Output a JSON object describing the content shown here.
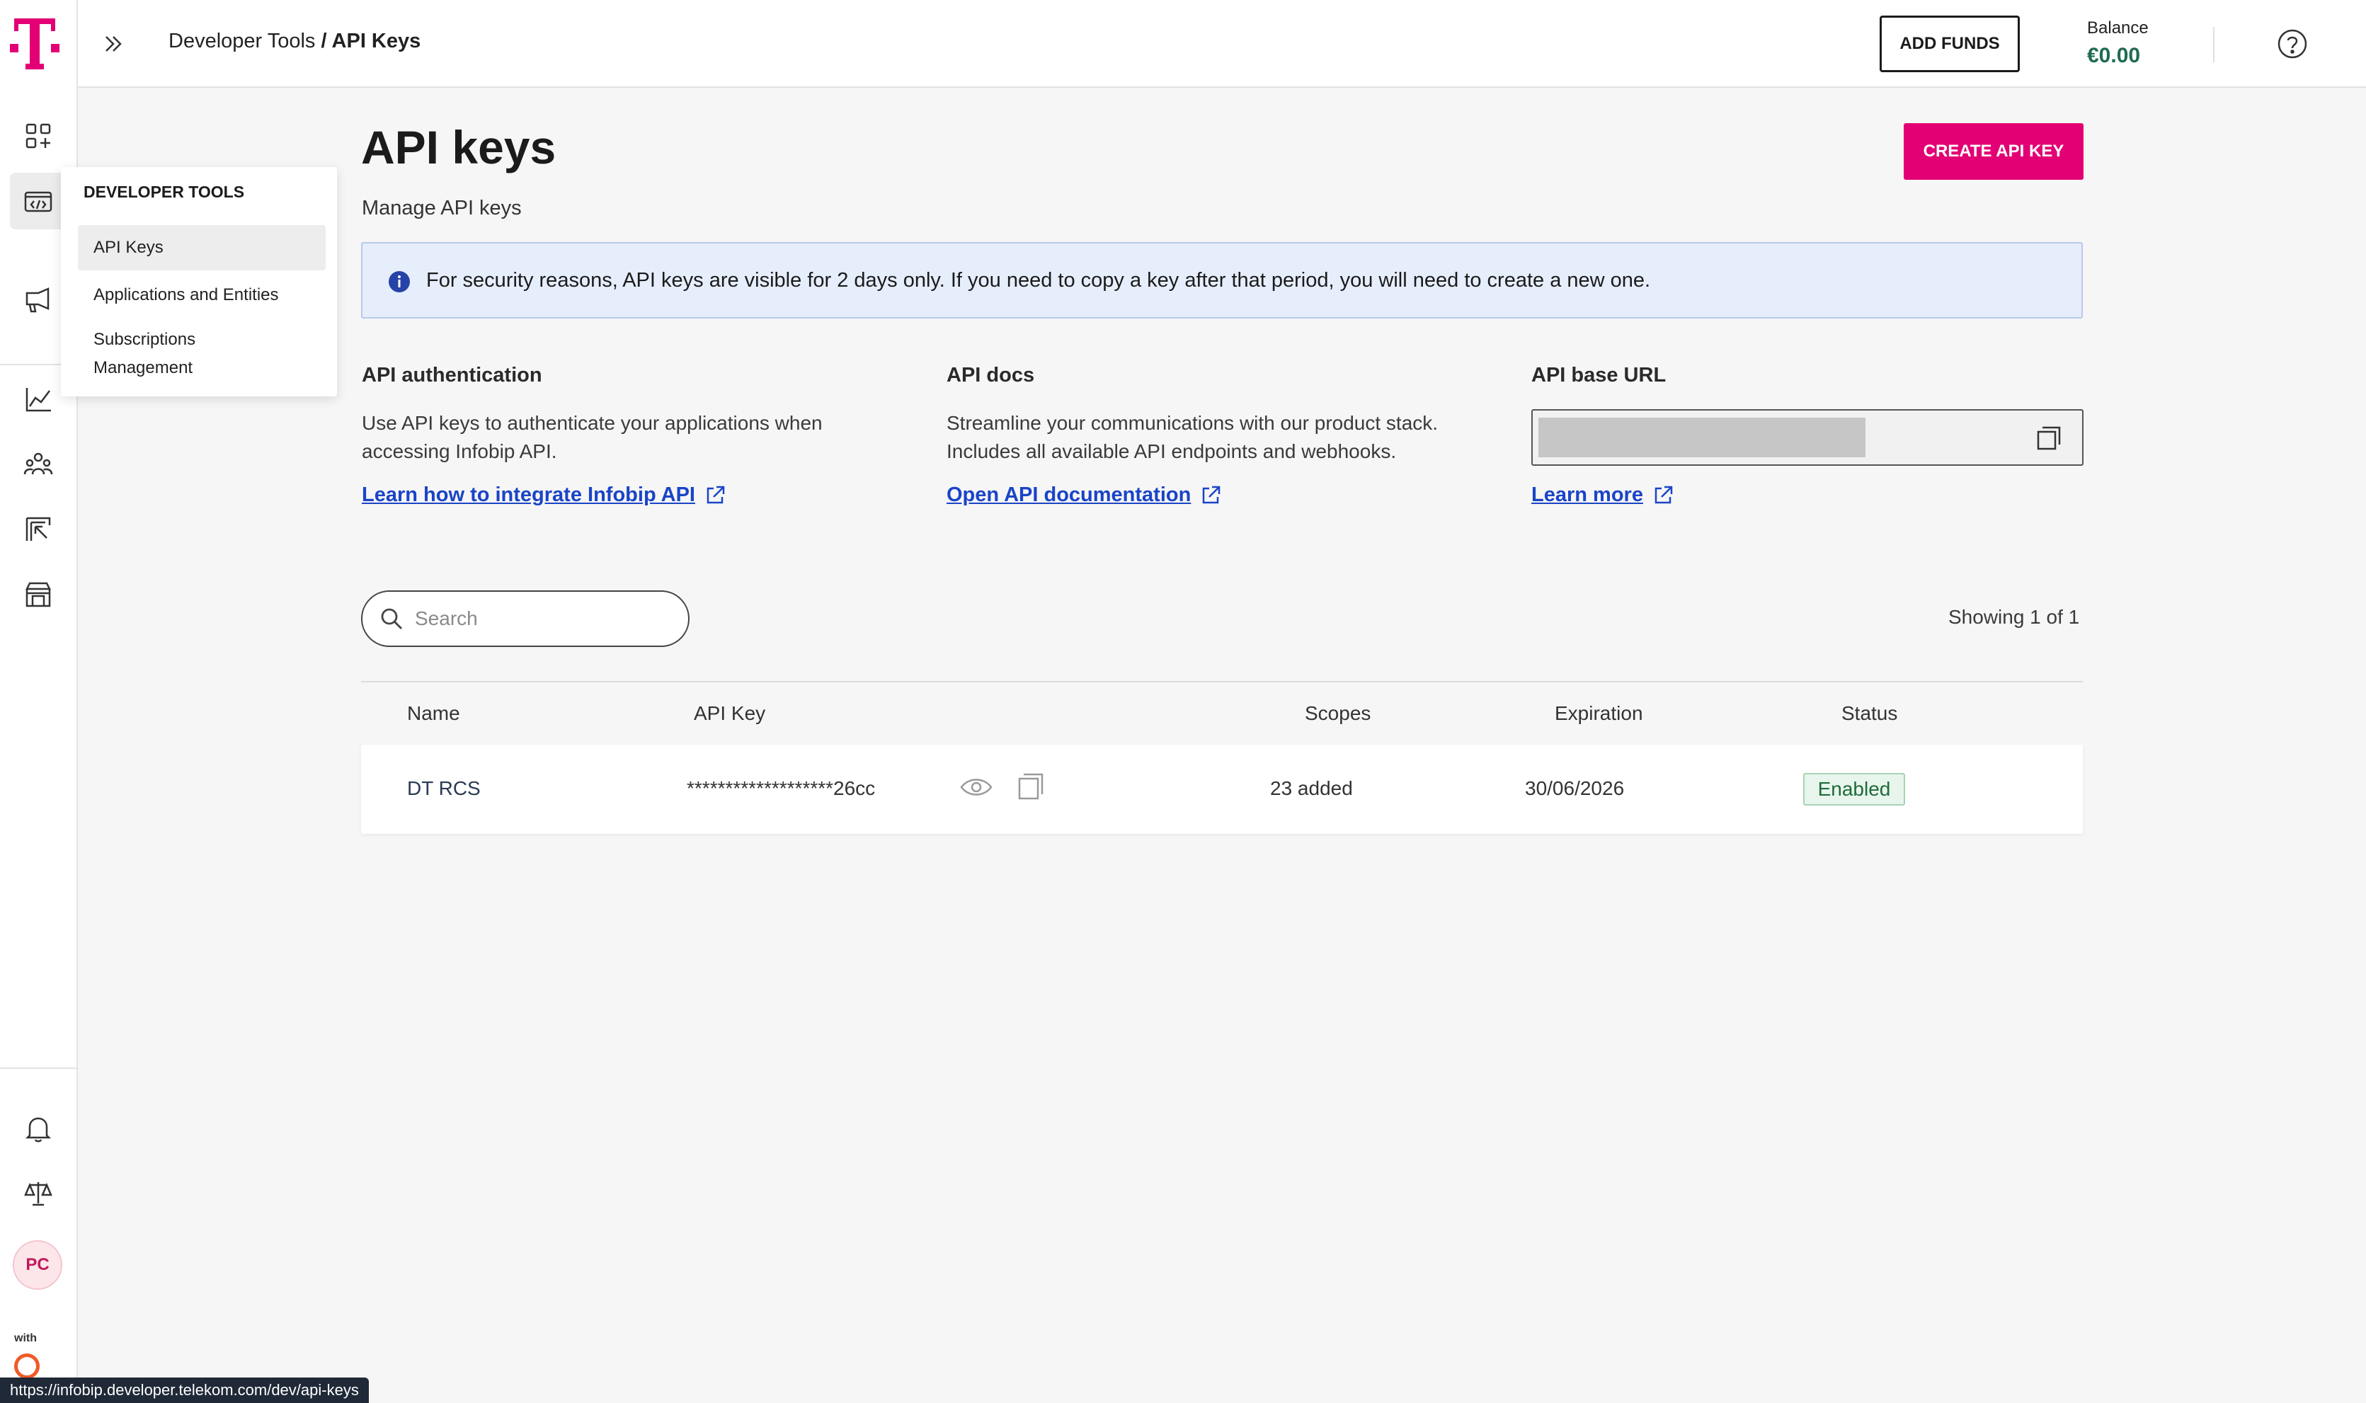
{
  "header": {
    "breadcrumb_parent": "Developer Tools",
    "breadcrumb_separator": " / ",
    "breadcrumb_current": "API Keys",
    "add_funds_label": "ADD FUNDS",
    "balance_label": "Balance",
    "balance_value": "€0.00"
  },
  "sidebar": {
    "icons": [
      "apps-add-icon",
      "developer-tools-icon",
      "campaign-icon",
      "analytics-icon",
      "people-icon",
      "exchange-icon",
      "marketplace-icon",
      "bell-icon",
      "scale-icon"
    ],
    "avatar_initials": "PC",
    "with_label": "with"
  },
  "menu": {
    "title": "DEVELOPER TOOLS",
    "items": [
      "API Keys",
      "Applications and Entities",
      "Subscriptions Management"
    ]
  },
  "page": {
    "title": "API keys",
    "subtitle": "Manage API keys",
    "create_button": "CREATE API KEY",
    "info_banner": "For security reasons, API keys are visible for 2 days only. If you need to copy a key after that period, you will need to create a new one."
  },
  "columns": [
    {
      "title": "API authentication",
      "description": "Use API keys to authenticate your applications when accessing Infobip API.",
      "link": "Learn how to integrate Infobip API"
    },
    {
      "title": "API docs",
      "description": "Streamline your communications with our product stack. Includes all available API endpoints and webhooks.",
      "link": "Open API documentation"
    },
    {
      "title": "API base URL",
      "link": "Learn more"
    }
  ],
  "search": {
    "placeholder": "Search"
  },
  "showing": "Showing 1 of 1",
  "table": {
    "headers": [
      "Name",
      "API Key",
      "Scopes",
      "Expiration",
      "Status"
    ],
    "rows": [
      {
        "name": "DT RCS",
        "api_key": "*******************26cc",
        "scopes": "23 added",
        "expiration": "30/06/2026",
        "status": "Enabled"
      }
    ]
  },
  "status_bar_url": "https://infobip.developer.telekom.com/dev/api-keys",
  "colors": {
    "brand": "#e20074",
    "link": "#1a44c7",
    "balance": "#1e6b52",
    "status_enabled": "#1e6b3a",
    "info_bg": "#e6eefc"
  }
}
